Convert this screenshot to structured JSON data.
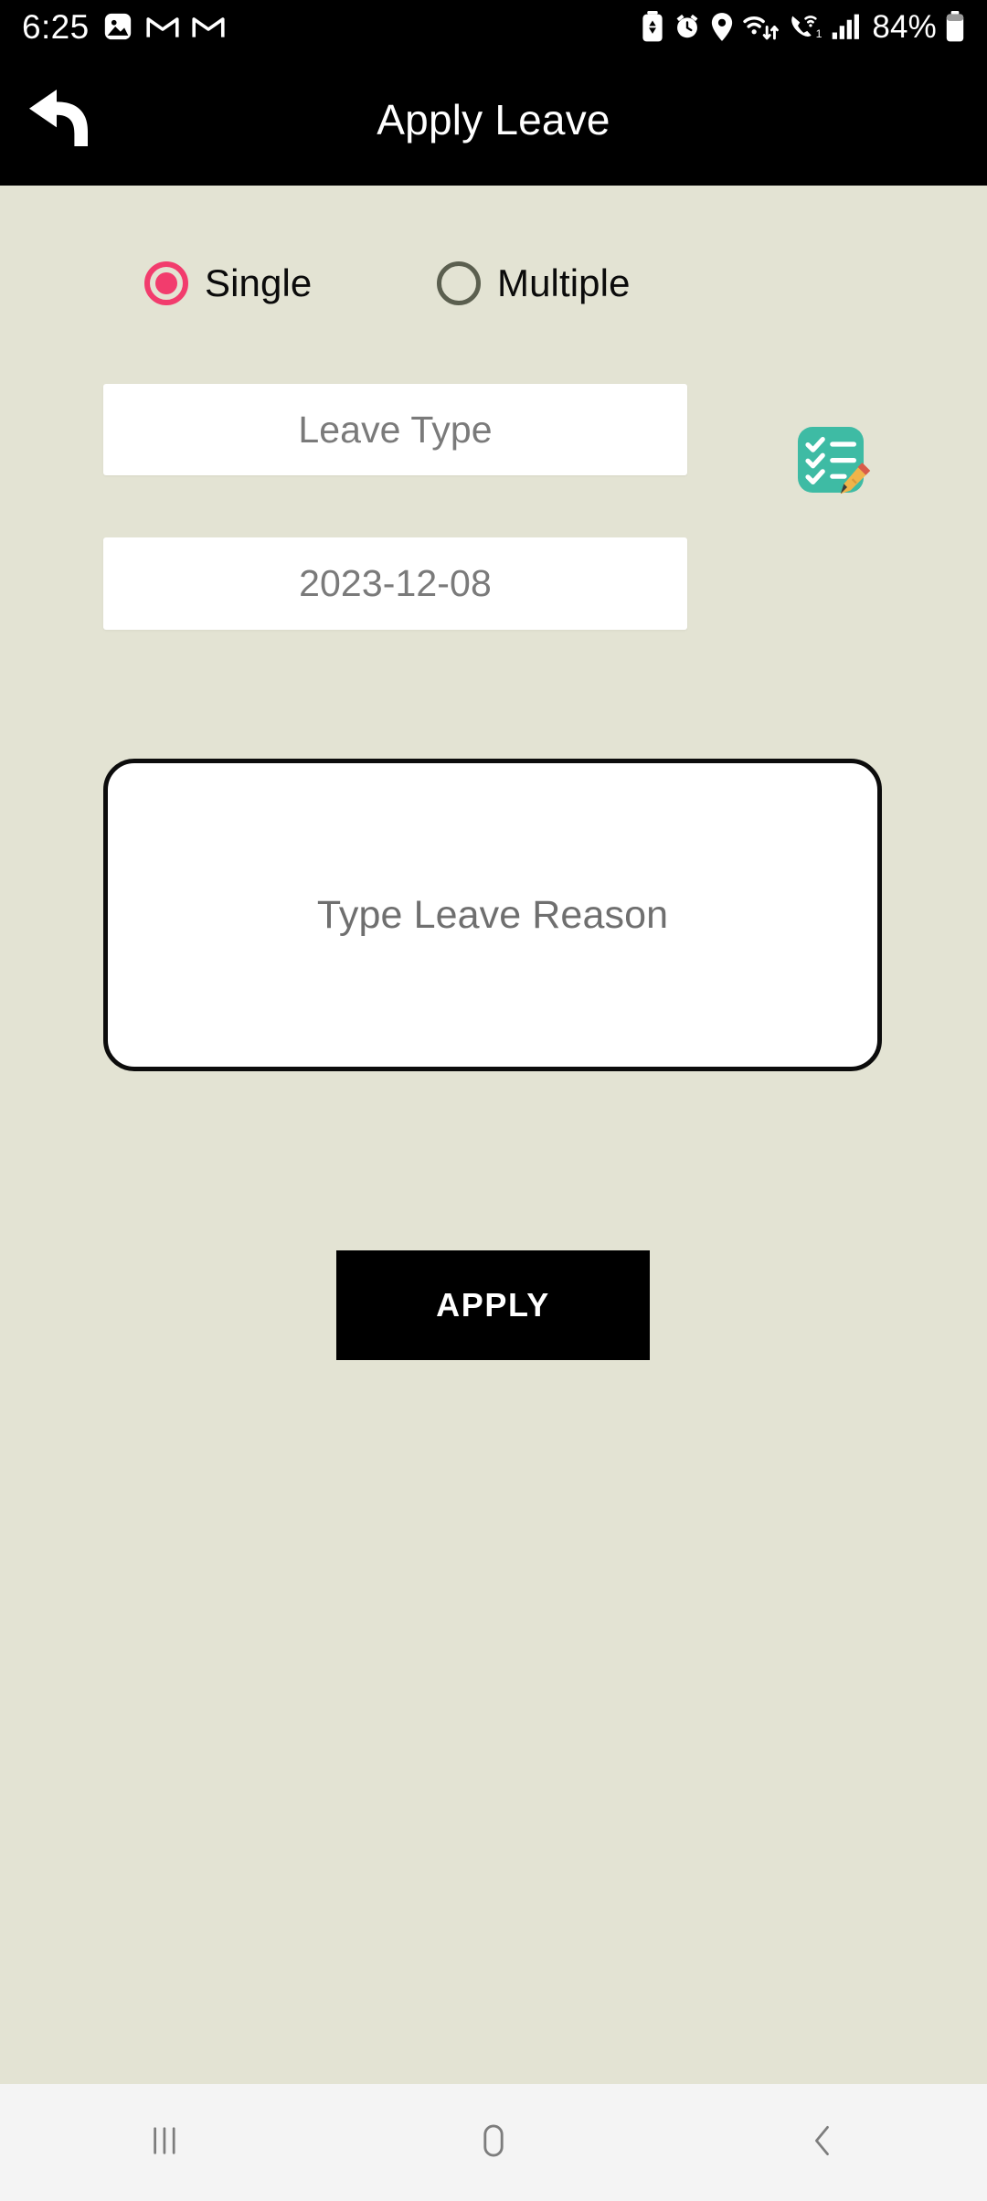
{
  "status_bar": {
    "time": "6:25",
    "battery_percent": "84%",
    "left_icons": [
      "photos-icon",
      "gmail-icon",
      "gmail-icon"
    ],
    "right_icons": [
      "battery-saver-icon",
      "alarm-icon",
      "location-icon",
      "wifi-data-icon",
      "wifi-calling-icon",
      "cellular-signal-icon",
      "battery-icon"
    ],
    "background_color": "#000000",
    "foreground_color": "#ffffff"
  },
  "app_bar": {
    "title": "Apply Leave",
    "back_icon": "back-arrow-icon",
    "background_color": "#000000",
    "title_color": "#ffffff"
  },
  "theme": {
    "page_background": "#e3e3d3",
    "accent_selected": "#f23c6d",
    "radio_unselected": "#5b5f4f",
    "field_background": "#ffffff",
    "placeholder_color": "#7a7a7a",
    "button_background": "#000000",
    "button_text_color": "#ffffff",
    "checklist_icon_color": "#3ebba4",
    "nav_bar_background": "#f4f4f4"
  },
  "form": {
    "mode_options": [
      {
        "label": "Single",
        "selected": true
      },
      {
        "label": "Multiple",
        "selected": false
      }
    ],
    "leave_type": {
      "value": "",
      "placeholder": "Leave Type"
    },
    "leave_date": {
      "value": "2023-12-08",
      "placeholder": "2023-12-08"
    },
    "leave_reason": {
      "value": "",
      "placeholder": "Type Leave Reason"
    },
    "picker_icon": "checklist-pencil-icon",
    "submit_label": "APPLY"
  },
  "nav_bar": {
    "recents_label": "recents-icon",
    "home_label": "home-icon",
    "back_label": "back-icon"
  }
}
